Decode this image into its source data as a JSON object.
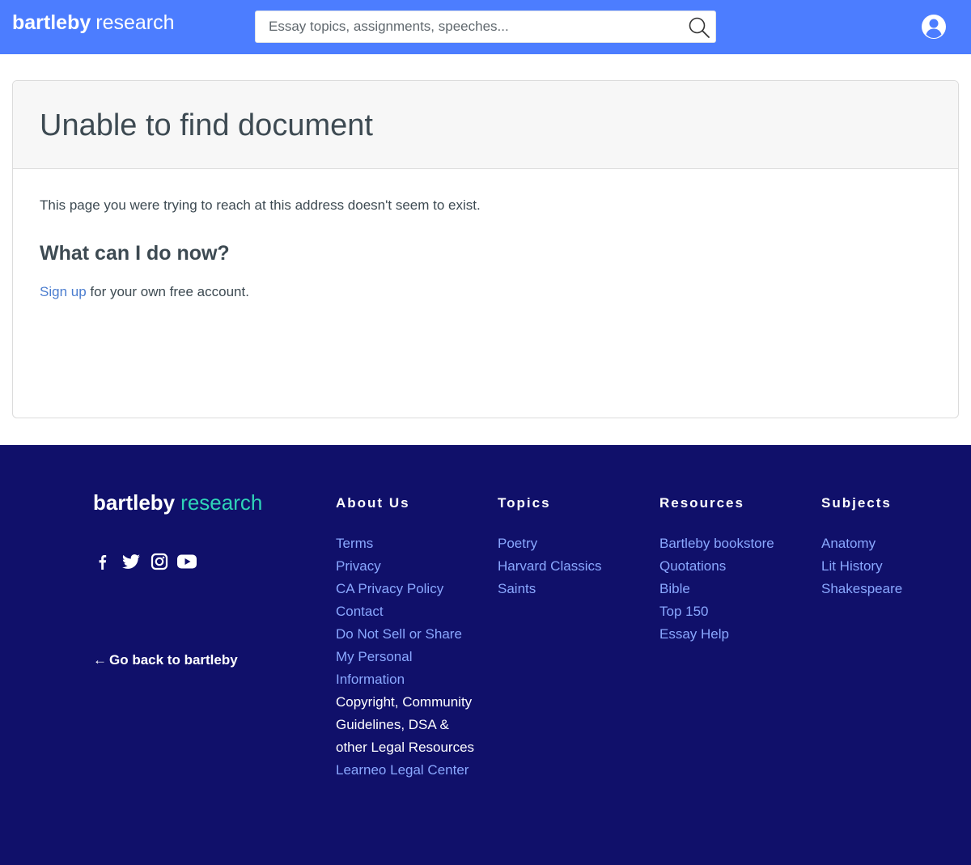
{
  "header": {
    "logo_bold": "bartleby",
    "logo_light": "research",
    "search_placeholder": "Essay topics, assignments, speeches..."
  },
  "main": {
    "title": "Unable to find document",
    "message": "This page you were trying to reach at this address doesn't seem to exist.",
    "subheading": "What can I do now?",
    "signup_link": "Sign up",
    "signup_rest": " for your own free account."
  },
  "footer": {
    "logo_bold": "bartleby",
    "logo_light": "research",
    "socials": [
      "facebook-icon",
      "twitter-icon",
      "instagram-icon",
      "youtube-icon"
    ],
    "go_back": "Go back to bartleby",
    "columns": [
      {
        "heading": "About Us",
        "links": [
          {
            "label": "Terms"
          },
          {
            "label": "Privacy"
          },
          {
            "label": "CA Privacy Policy"
          },
          {
            "label": "Contact"
          },
          {
            "label": "Do Not Sell or Share My Personal Information"
          },
          {
            "label": "Copyright, Community Guidelines, DSA & other Legal Resources",
            "plain": true
          },
          {
            "label": "Learneo Legal Center"
          }
        ]
      },
      {
        "heading": "Topics",
        "links": [
          {
            "label": "Poetry"
          },
          {
            "label": "Harvard Classics"
          },
          {
            "label": "Saints"
          }
        ]
      },
      {
        "heading": "Resources",
        "links": [
          {
            "label": "Bartleby bookstore"
          },
          {
            "label": "Quotations"
          },
          {
            "label": "Bible"
          },
          {
            "label": "Top 150"
          },
          {
            "label": "Essay Help"
          }
        ]
      },
      {
        "heading": "Subjects",
        "links": [
          {
            "label": "Anatomy"
          },
          {
            "label": "Lit History"
          },
          {
            "label": "Shakespeare"
          }
        ]
      }
    ]
  },
  "colors": {
    "header_bg": "#4c7dff",
    "footer_bg": "#10106a",
    "link": "#4b7dcf",
    "footer_link": "#8aa8ff",
    "accent_teal": "#2fd3b7"
  }
}
